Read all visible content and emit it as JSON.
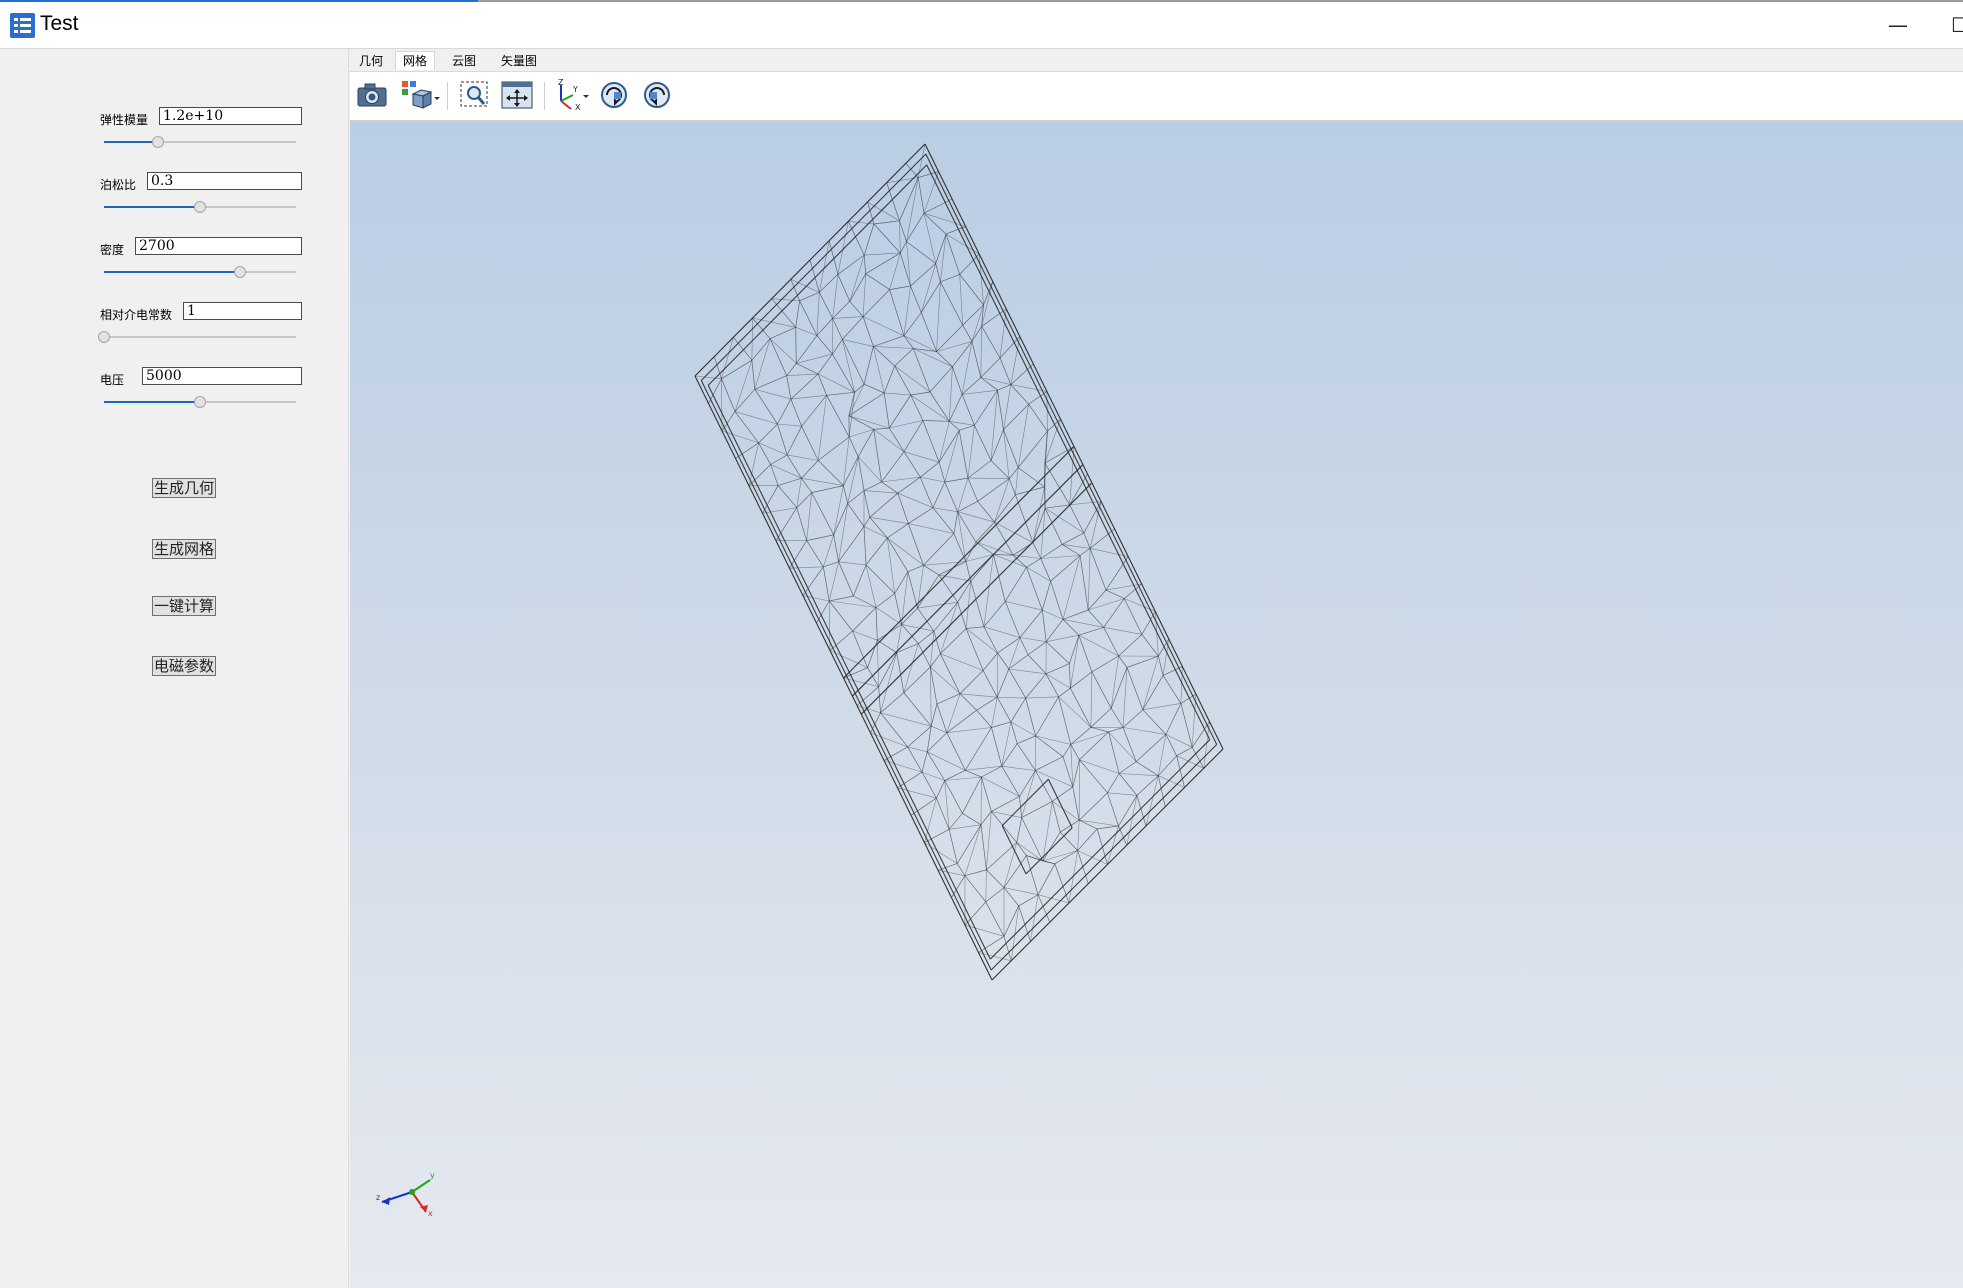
{
  "window": {
    "title": "Test",
    "minimize_glyph": "—",
    "maximize_glyph": "☐"
  },
  "params": [
    {
      "label": "弹性模量",
      "value": "1.2e+10",
      "slider_fraction": 0.28
    },
    {
      "label": "泊松比",
      "value": "0.3",
      "slider_fraction": 0.5
    },
    {
      "label": "密度",
      "value": "2700",
      "slider_fraction": 0.71
    },
    {
      "label": "相对介电常数",
      "value": "1",
      "slider_fraction": 0.0
    },
    {
      "label": "电压",
      "value": "5000",
      "slider_fraction": 0.5
    }
  ],
  "actions": {
    "generate_geometry": "生成几何",
    "generate_mesh": "生成网格",
    "compute": "一键计算",
    "em_params": "电磁参数"
  },
  "tabs": [
    "几何",
    "网格",
    "云图",
    "矢量图"
  ],
  "active_tab": "网格",
  "toolbar_icons": [
    "camera-icon",
    "view-cube-icon",
    "zoom-box-icon",
    "fit-all-icon",
    "axes-orientation-icon",
    "rotate-cw-icon",
    "rotate-ccw-icon"
  ],
  "colors": {
    "accent": "#1d66bd",
    "viewport_top": "#b9cde4",
    "viewport_bottom": "#e6e9ef",
    "mesh": "#2b2b2b",
    "axis_x": "#d42a2a",
    "axis_y": "#1fa51f",
    "axis_z": "#1a33c9"
  },
  "triad_labels": {
    "x": "x",
    "y": "y",
    "z": "z"
  }
}
